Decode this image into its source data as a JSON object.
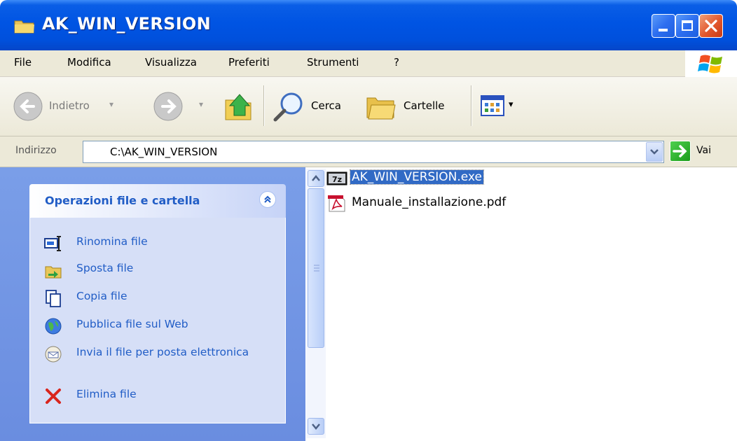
{
  "window": {
    "title": "AK_WIN_VERSION",
    "title_icon": "folder-icon",
    "controls": [
      "minimize-icon",
      "maximize-icon",
      "close-icon"
    ]
  },
  "menu": {
    "items": [
      "File",
      "Modifica",
      "Visualizza",
      "Preferiti",
      "Strumenti",
      "?"
    ]
  },
  "toolbar": {
    "back_label": "Indietro",
    "search_label": "Cerca",
    "folders_label": "Cartelle"
  },
  "address": {
    "label": "Indirizzo",
    "value": "C:\\AK_WIN_VERSION",
    "go_label": "Vai"
  },
  "taskpane": {
    "title": "Operazioni file e cartella",
    "items": [
      {
        "label": "Rinomina file",
        "icon": "rename-icon"
      },
      {
        "label": "Sposta file",
        "icon": "move-icon"
      },
      {
        "label": "Copia file",
        "icon": "copy-icon"
      },
      {
        "label": "Pubblica file sul Web",
        "icon": "web-publish-icon"
      },
      {
        "label": "Invia il file per posta elettronica",
        "icon": "email-icon"
      },
      {
        "label": "Elimina file",
        "icon": "delete-icon"
      }
    ]
  },
  "files": [
    {
      "name": "AK_WIN_VERSION.exe",
      "icon": "7z-icon",
      "selected": true
    },
    {
      "name": "Manuale_installazione.pdf",
      "icon": "pdf-icon",
      "selected": false
    }
  ],
  "colors": {
    "titlebar": "#0054e3",
    "taskpane_bg": "#6a8de0",
    "task_link": "#215dc6",
    "selection": "#316ac5"
  }
}
